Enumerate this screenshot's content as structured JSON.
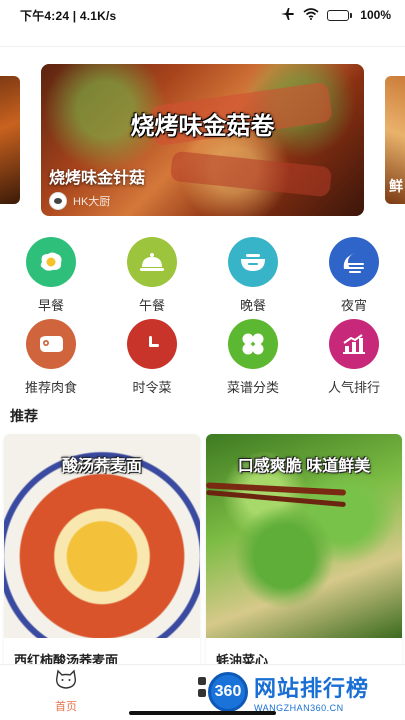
{
  "status_bar": {
    "time_speed": "下午4:24 | 4.1K/s",
    "battery_percent": "100%",
    "battery_level": 1.0
  },
  "banner": {
    "headline": "烧烤味金菇卷",
    "title": "烧烤味金针菇",
    "author": "HK大厨",
    "side_right_text": "鲜"
  },
  "categories": [
    {
      "label": "早餐",
      "icon": "fried-egg-icon",
      "color": "#2ec07b"
    },
    {
      "label": "午餐",
      "icon": "cloche-icon",
      "color": "#9cc43c"
    },
    {
      "label": "晚餐",
      "icon": "bowl-icon",
      "color": "#37b4c8"
    },
    {
      "label": "夜宵",
      "icon": "moon-icon",
      "color": "#2f64c8"
    },
    {
      "label": "推荐肉食",
      "icon": "meat-icon",
      "color": "#d0643c"
    },
    {
      "label": "时令菜",
      "icon": "clock-icon",
      "color": "#c8342a"
    },
    {
      "label": "菜谱分类",
      "icon": "clover-icon",
      "color": "#5cb830"
    },
    {
      "label": "人气排行",
      "icon": "chart-icon",
      "color": "#c8287a"
    }
  ],
  "section": {
    "title": "推荐"
  },
  "recipes": [
    {
      "overlay": "酸汤荞麦面",
      "name": "西红柿酸汤荞麦面"
    },
    {
      "overlay": "口感爽脆 味道鲜美",
      "name": "蚝油菜心"
    }
  ],
  "bottom_nav": {
    "home_label": "首页"
  },
  "watermark": {
    "badge": "360",
    "cn": "网站排行榜",
    "en": "WANGZHAN360.CN"
  }
}
